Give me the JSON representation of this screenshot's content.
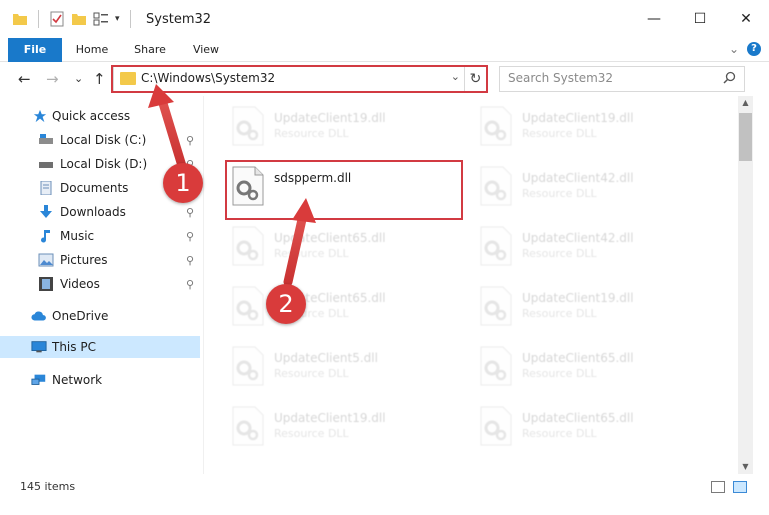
{
  "window": {
    "title": "System32",
    "minimize_glyph": "—",
    "maximize_glyph": "☐",
    "close_glyph": "✕"
  },
  "ribbon": {
    "tabs": [
      "File",
      "Home",
      "Share",
      "View"
    ],
    "help_glyph": "?",
    "expand_glyph": "⌄"
  },
  "address": {
    "path": "C:\\Windows\\System32",
    "dropdown_glyph": "⌄",
    "refresh_glyph": "↻",
    "search_placeholder": "Search System32"
  },
  "nav_buttons": {
    "back": "←",
    "forward": "→",
    "recent": "⌄",
    "up": "↑"
  },
  "sidebar": {
    "items": [
      {
        "label": "Quick access",
        "icon": "star-icon",
        "pinned": false
      },
      {
        "label": "Local Disk (C:)",
        "icon": "drive-icon",
        "pinned": true
      },
      {
        "label": "Local Disk (D:)",
        "icon": "drive-icon",
        "pinned": true
      },
      {
        "label": "Documents",
        "icon": "documents-icon",
        "pinned": true
      },
      {
        "label": "Downloads",
        "icon": "download-icon",
        "pinned": true
      },
      {
        "label": "Music",
        "icon": "music-icon",
        "pinned": true
      },
      {
        "label": "Pictures",
        "icon": "pictures-icon",
        "pinned": true
      },
      {
        "label": "Videos",
        "icon": "videos-icon",
        "pinned": true
      },
      {
        "label": "OneDrive",
        "icon": "cloud-icon",
        "pinned": false
      },
      {
        "label": "This PC",
        "icon": "computer-icon",
        "pinned": false,
        "selected": true
      },
      {
        "label": "Network",
        "icon": "network-icon",
        "pinned": false
      }
    ],
    "pin_glyph": "📌"
  },
  "files": {
    "left": [
      {
        "name": "UpdateClient19.dll",
        "type": "Resource DLL",
        "faded": true
      },
      {
        "name": "sdspperm.dll",
        "type": "",
        "faded": false
      },
      {
        "name": "UpdateClient65.dll",
        "type": "Resource DLL",
        "faded": true
      },
      {
        "name": "UpdateClient65.dll",
        "type": "Resource DLL",
        "faded": true
      },
      {
        "name": "UpdateClient5.dll",
        "type": "Resource DLL",
        "faded": true
      },
      {
        "name": "UpdateClient19.dll",
        "type": "Resource DLL",
        "faded": true
      }
    ],
    "right": [
      {
        "name": "UpdateClient19.dll",
        "type": "Resource DLL",
        "faded": true
      },
      {
        "name": "UpdateClient42.dll",
        "type": "Resource DLL",
        "faded": true
      },
      {
        "name": "UpdateClient42.dll",
        "type": "Resource DLL",
        "faded": true
      },
      {
        "name": "UpdateClient19.dll",
        "type": "Resource DLL",
        "faded": true
      },
      {
        "name": "UpdateClient65.dll",
        "type": "Resource DLL",
        "faded": true
      },
      {
        "name": "UpdateClient65.dll",
        "type": "Resource DLL",
        "faded": true
      }
    ]
  },
  "status": {
    "item_count": "145 items"
  },
  "annotations": {
    "step1": "1",
    "step2": "2"
  },
  "colors": {
    "accent": "#1979ca",
    "highlight": "#d23a42",
    "badge": "#d93b3b",
    "selected": "#cce8ff"
  }
}
